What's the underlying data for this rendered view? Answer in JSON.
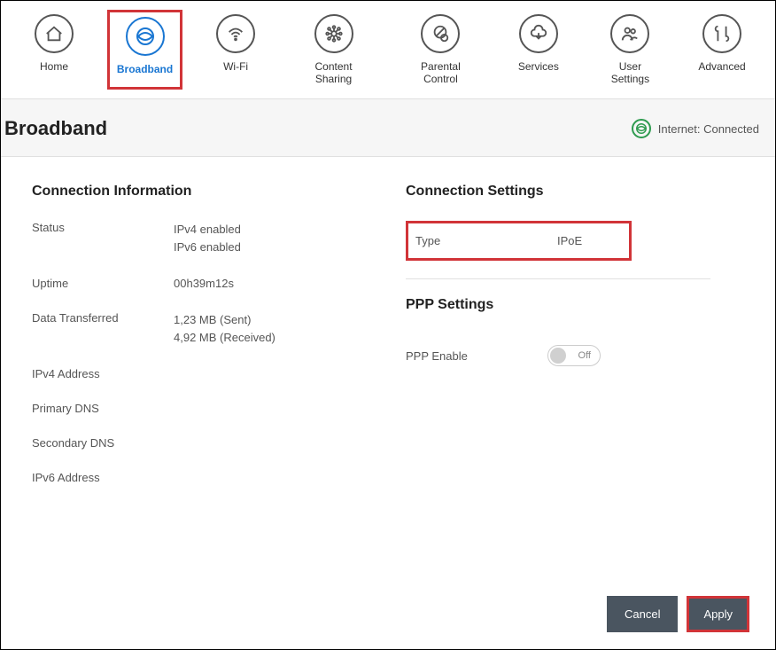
{
  "nav": {
    "items": [
      {
        "label": "Home"
      },
      {
        "label": "Broadband"
      },
      {
        "label": "Wi-Fi"
      },
      {
        "label": "Content Sharing"
      },
      {
        "label": "Parental Control"
      },
      {
        "label": "Services"
      },
      {
        "label": "User Settings"
      },
      {
        "label": "Advanced"
      }
    ]
  },
  "page": {
    "title": "Broadband",
    "status": "Internet: Connected"
  },
  "connection_info": {
    "heading": "Connection Information",
    "status_label": "Status",
    "status_value_ipv4": "IPv4 enabled",
    "status_value_ipv6": "IPv6 enabled",
    "uptime_label": "Uptime",
    "uptime_value": "00h39m12s",
    "data_transferred_label": "Data Transferred",
    "data_sent": "1,23 MB (Sent)",
    "data_received": "4,92 MB (Received)",
    "ipv4_label": "IPv4 Address",
    "primary_dns_label": "Primary DNS",
    "secondary_dns_label": "Secondary DNS",
    "ipv6_label": "IPv6 Address"
  },
  "connection_settings": {
    "heading": "Connection Settings",
    "type_label": "Type",
    "type_value": "IPoE"
  },
  "ppp_settings": {
    "heading": "PPP Settings",
    "ppp_enable_label": "PPP Enable",
    "ppp_enable_value": "Off"
  },
  "buttons": {
    "cancel": "Cancel",
    "apply": "Apply"
  }
}
